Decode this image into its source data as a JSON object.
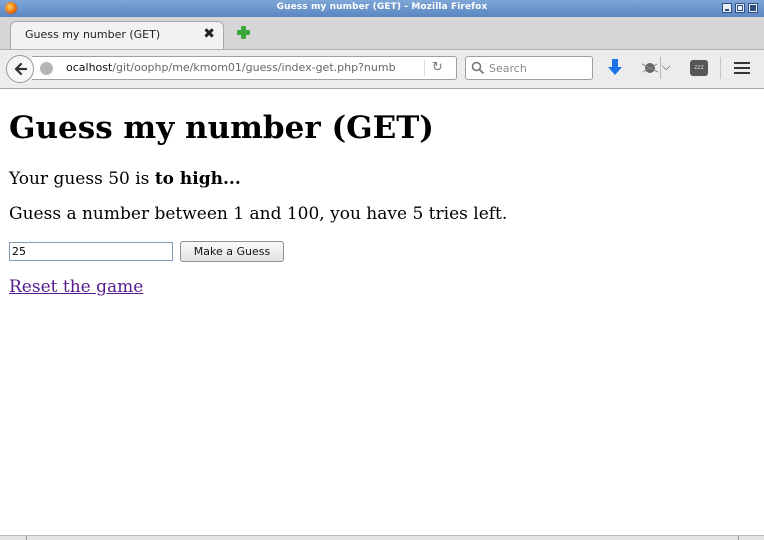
{
  "window": {
    "title": "Guess my number (GET) - Mozilla Firefox"
  },
  "tabs": [
    {
      "label": "Guess my number (GET)",
      "close": "✖"
    }
  ],
  "navbar": {
    "url_host": "ocalhost",
    "url_path": "/git/oophp/me/kmom01/guess/index-get.php?numb",
    "search_placeholder": "Search",
    "zzz_label": "zzz"
  },
  "page": {
    "heading": "Guess my number (GET)",
    "result_prefix": "Your guess 50 is ",
    "result_strong": "to high...",
    "instructions": "Guess a number between 1 and 100, you have 5 tries left.",
    "guess_value": "25",
    "guess_button": "Make a Guess",
    "reset_link": "Reset the game"
  },
  "colors": {
    "titlebar": "#5b86c2",
    "link_visited": "#551a8b",
    "newtab_plus": "#3aa53a",
    "download_arrow": "#1a73e8"
  },
  "icons": [
    "firefox-icon",
    "tab-close-icon",
    "new-tab-icon",
    "back-arrow-icon",
    "globe-icon",
    "reload-icon",
    "search-icon",
    "download-icon",
    "extension-icon",
    "chevron-down-icon",
    "zzz-icon",
    "hamburger-menu-icon"
  ]
}
